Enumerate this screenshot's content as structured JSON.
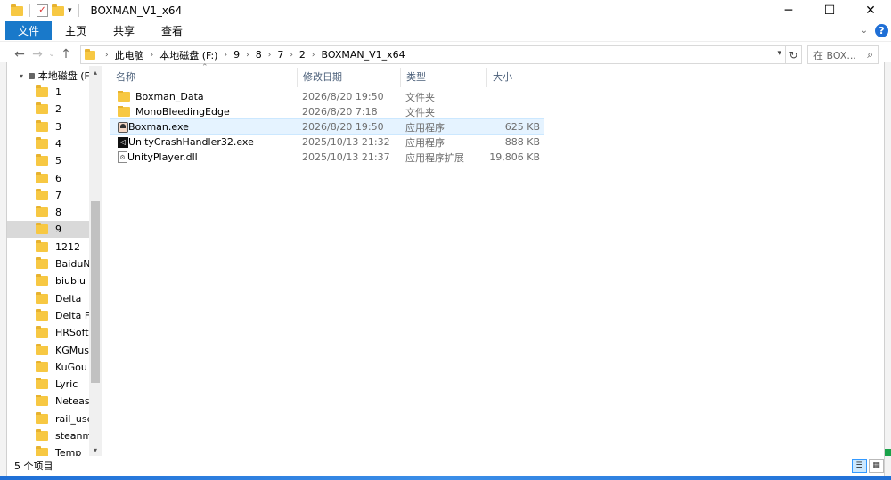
{
  "window": {
    "title": "BOXMAN_V1_x64",
    "minimize": "─",
    "maximize": "☐",
    "close": "✕"
  },
  "ribbon": {
    "tabs": [
      "文件",
      "主页",
      "共享",
      "查看"
    ],
    "help": "?"
  },
  "address": {
    "crumbs": [
      "此电脑",
      "本地磁盘 (F:)",
      "9",
      "8",
      "7",
      "2",
      "BOXMAN_V1_x64"
    ],
    "search_placeholder": "在 BOX..."
  },
  "nav": {
    "root": "本地磁盘 (F:)",
    "items": [
      "1",
      "2",
      "3",
      "4",
      "5",
      "6",
      "7",
      "8",
      "9",
      "1212",
      "BaiduNet",
      "biubiu",
      "Delta",
      "Delta Force",
      "HRSoftstore",
      "KGMusic",
      "KuGou",
      "Lyric",
      "Netease",
      "rail_user_data",
      "steanm",
      "Temp"
    ],
    "selected_index": 8
  },
  "columns": {
    "name": "名称",
    "date": "修改日期",
    "type": "类型",
    "size": "大小"
  },
  "files": [
    {
      "name": "Boxman_Data",
      "date": "2026/8/20 19:50",
      "type": "文件夹",
      "size": "",
      "icon": "folder-icon"
    },
    {
      "name": "MonoBleedingEdge",
      "date": "2026/8/20 7:18",
      "type": "文件夹",
      "size": "",
      "icon": "folder-icon"
    },
    {
      "name": "Boxman.exe",
      "date": "2026/8/20 19:50",
      "type": "应用程序",
      "size": "625 KB",
      "icon": "exe-icon"
    },
    {
      "name": "UnityCrashHandler32.exe",
      "date": "2025/10/13 21:32",
      "type": "应用程序",
      "size": "888 KB",
      "icon": "unity-icon"
    },
    {
      "name": "UnityPlayer.dll",
      "date": "2025/10/13 21:37",
      "type": "应用程序扩展",
      "size": "19,806 KB",
      "icon": "dll-icon"
    }
  ],
  "status": {
    "count": "5 个项目"
  },
  "colors": {
    "accent": "#1979ca",
    "folder": "#f7c843",
    "selection": "#d9d9d9",
    "hover": "#e5f3ff"
  }
}
